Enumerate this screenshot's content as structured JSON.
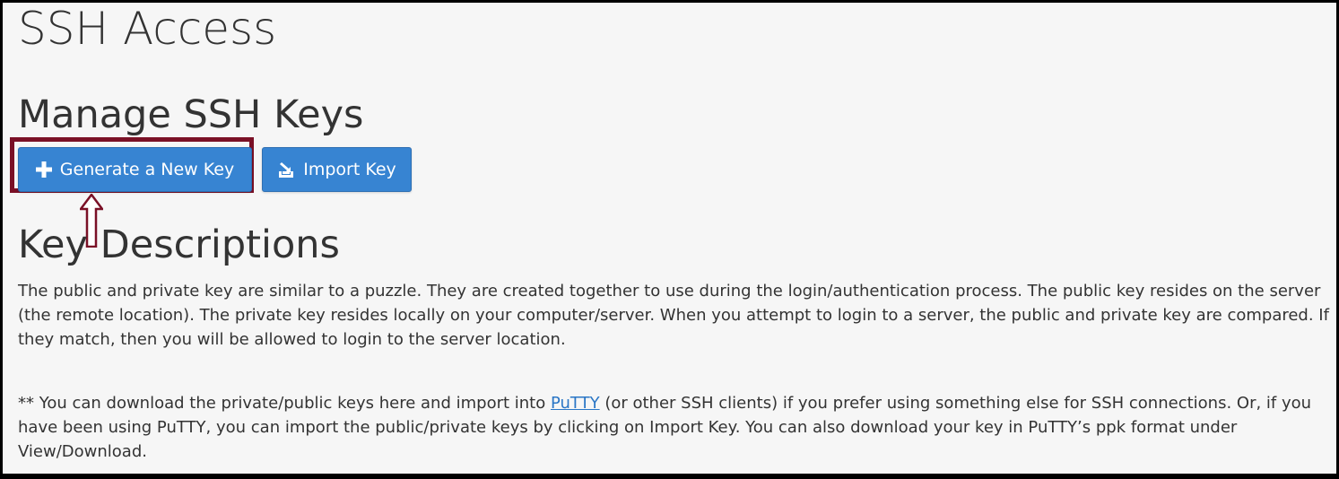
{
  "page": {
    "title": "SSH Access"
  },
  "manage": {
    "heading": "Manage SSH Keys",
    "generate_label": "Generate a New Key",
    "import_label": "Import Key"
  },
  "descriptions": {
    "heading": "Key Descriptions",
    "paragraph_1": "The public and private key are similar to a puzzle. They are created together to use during the login/authentication process. The public key resides on the server (the remote location). The private key resides locally on your computer/server. When you attempt to login to a server, the public and private key are compared. If they match, then you will be allowed to login to the server location.",
    "paragraph_2_before_link": "** You can download the private/public keys here and import into ",
    "putty_link": "PuTTY",
    "paragraph_2_after_link": " (or other SSH clients) if you prefer using something else for SSH connections. Or, if you have been using PuTTY, you can import the public/private keys by clicking on Import Key. You can also download your key in PuTTY’s ppk format under View/Download."
  },
  "icons": {
    "generate": "plus-icon",
    "import": "import-icon",
    "annotation": "up-arrow-icon"
  },
  "colors": {
    "button": "#3784d2",
    "annotation": "#7a1026",
    "link": "#2a76c6",
    "text": "#333333",
    "background": "#f6f6f6"
  }
}
